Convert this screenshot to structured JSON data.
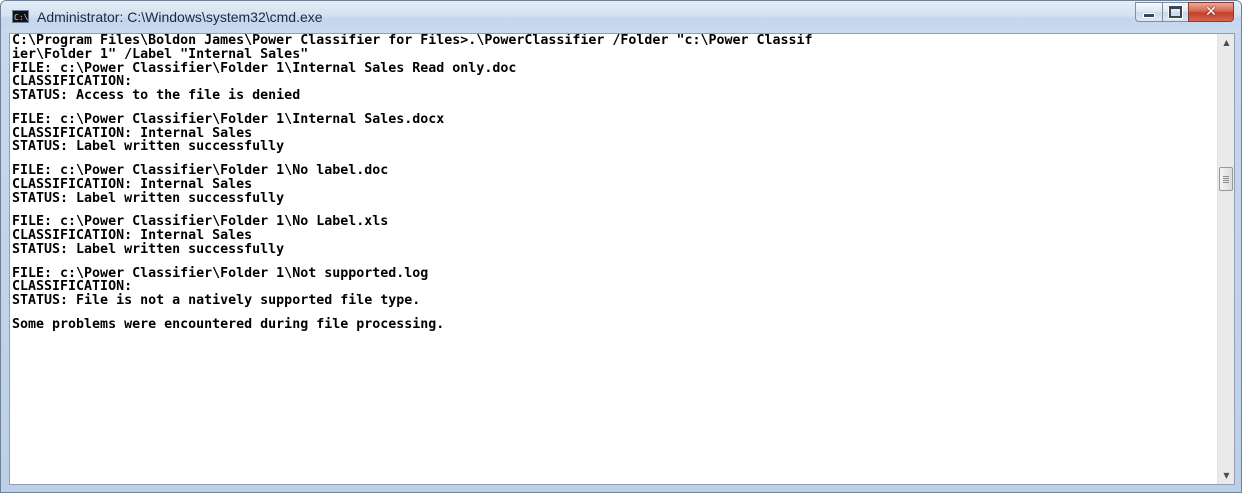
{
  "window": {
    "title": "Administrator: C:\\Windows\\system32\\cmd.exe",
    "icon": "console-icon",
    "icon_text": "C:\\."
  },
  "caption_buttons": {
    "minimize": "minimize-icon",
    "maximize": "maximize-icon",
    "close": "close-icon",
    "close_glyph": "✕"
  },
  "colors": {
    "console_background": "#ffffff",
    "console_text": "#000000",
    "close_button": "#c4402a",
    "titlebar": "#c9daef"
  },
  "console": {
    "lines": [
      "C:\\Program Files\\Boldon James\\Power Classifier for Files>.\\PowerClassifier /Folder \"c:\\Power Classif",
      "ier\\Folder 1\" /Label \"Internal Sales\"",
      "FILE: c:\\Power Classifier\\Folder 1\\Internal Sales Read only.doc",
      "CLASSIFICATION:",
      "STATUS: Access to the file is denied",
      "",
      "FILE: c:\\Power Classifier\\Folder 1\\Internal Sales.docx",
      "CLASSIFICATION: Internal Sales",
      "STATUS: Label written successfully",
      "",
      "FILE: c:\\Power Classifier\\Folder 1\\No label.doc",
      "CLASSIFICATION: Internal Sales",
      "STATUS: Label written successfully",
      "",
      "FILE: c:\\Power Classifier\\Folder 1\\No Label.xls",
      "CLASSIFICATION: Internal Sales",
      "STATUS: Label written successfully",
      "",
      "FILE: c:\\Power Classifier\\Folder 1\\Not supported.log",
      "CLASSIFICATION:",
      "STATUS: File is not a natively supported file type.",
      "",
      "Some problems were encountered during file processing."
    ]
  },
  "scrollbar": {
    "up_arrow": "▲",
    "down_arrow": "▼"
  }
}
